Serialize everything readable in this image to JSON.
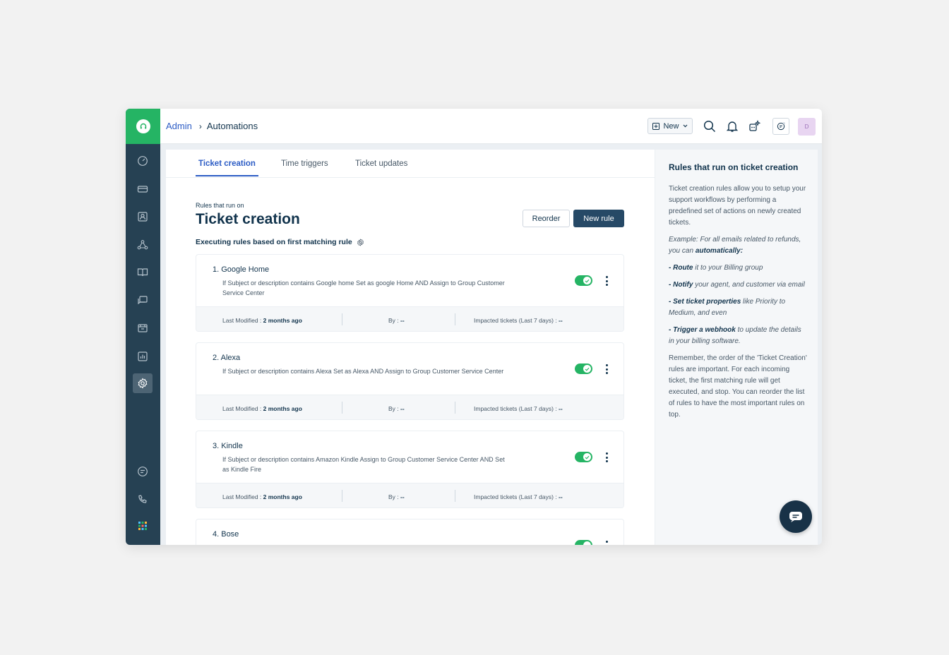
{
  "topbar": {
    "breadcrumb_admin": "Admin",
    "breadcrumb_sep": "›",
    "breadcrumb_current": "Automations",
    "new_button": "New",
    "avatar_initial": "D"
  },
  "tabs": [
    {
      "label": "Ticket creation"
    },
    {
      "label": "Time triggers"
    },
    {
      "label": "Ticket updates"
    }
  ],
  "header": {
    "subtitle": "Rules that run on",
    "title": "Ticket creation",
    "reorder_label": "Reorder",
    "new_rule_label": "New rule",
    "executing_label": "Executing rules based on first matching rule"
  },
  "rules": [
    {
      "title": "1.  Google Home",
      "description": "If Subject or description contains Google home Set as google Home AND Assign to Group Customer Service Center",
      "last_modified_label": "Last Modified : ",
      "last_modified_value": "2 months ago",
      "by_label": "By : ",
      "by_value": "--",
      "impacted_label": "Impacted tickets (Last 7 days) : ",
      "impacted_value": "--"
    },
    {
      "title": "2.  Alexa",
      "description": "If Subject or description contains Alexa Set as Alexa AND Assign to Group Customer Service Center",
      "last_modified_label": "Last Modified : ",
      "last_modified_value": "2 months ago",
      "by_label": "By : ",
      "by_value": "--",
      "impacted_label": "Impacted tickets (Last 7 days) : ",
      "impacted_value": "--"
    },
    {
      "title": "3.  Kindle",
      "description": "If Subject or description contains Amazon Kindle Assign to Group Customer Service Center AND Set as Kindle Fire",
      "last_modified_label": "Last Modified : ",
      "last_modified_value": "2 months ago",
      "by_label": "By : ",
      "by_value": "--",
      "impacted_label": "Impacted tickets (Last 7 days) : ",
      "impacted_value": "--"
    },
    {
      "title": "4.  Bose"
    }
  ],
  "right_panel": {
    "title": "Rules that run on ticket creation",
    "intro": "Ticket creation rules allow you to setup your support workflows by performing a predefined set of actions on newly created tickets.",
    "example_prefix": "Example: For all emails related to refunds, you can ",
    "example_bold": "automatically:",
    "item1_bold": "- Route",
    "item1_rest": " it to your Billing group",
    "item2_bold": "- Notify",
    "item2_rest": " your agent, and customer via email",
    "item3_bold": "- Set ticket properties",
    "item3_rest": " like Priority to Medium, and even",
    "item4_bold": "- Trigger a webhook",
    "item4_rest": " to update the details in your billing software.",
    "closing": "Remember, the order of the 'Ticket Creation' rules are important. For each incoming ticket, the first matching rule will get executed, and stop. You can reorder the list of rules to have the most important rules on top."
  }
}
